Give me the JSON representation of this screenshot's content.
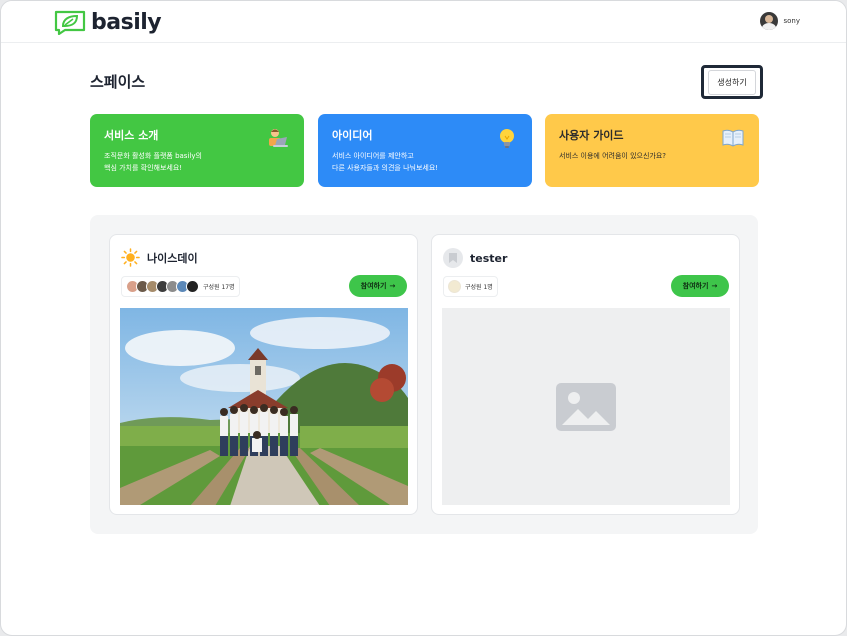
{
  "brand": {
    "name": "basily",
    "accent": "#43c743"
  },
  "user": {
    "name": "sony"
  },
  "page": {
    "title": "스페이스",
    "create_label": "생성하기"
  },
  "cards": [
    {
      "title": "서비스 소개",
      "desc": [
        "조직문화 활성화 플랫폼 basily의",
        "핵심 가치를 확인해보세요!"
      ],
      "icon": "person-laptop-icon",
      "color": "#43c743"
    },
    {
      "title": "아이디어",
      "desc": [
        "서비스 아이디어를 제안하고",
        "다른 사용자들과 의견을 나눠보세요!"
      ],
      "icon": "lightbulb-icon",
      "color": "#2d8bf7"
    },
    {
      "title": "사용자 가이드",
      "desc": [
        "서비스 이용에 어려움이 있으신가요?"
      ],
      "icon": "open-book-icon",
      "color": "#ffc94a"
    }
  ],
  "spaces": [
    {
      "title": "나이스데이",
      "members": "구성원 17명",
      "join_label": "참여하기",
      "icon": "sun-icon",
      "has_image": true
    },
    {
      "title": "tester",
      "members": "구성원 1명",
      "join_label": "참여하기",
      "icon": "placeholder-avatar-icon",
      "has_image": false
    }
  ]
}
